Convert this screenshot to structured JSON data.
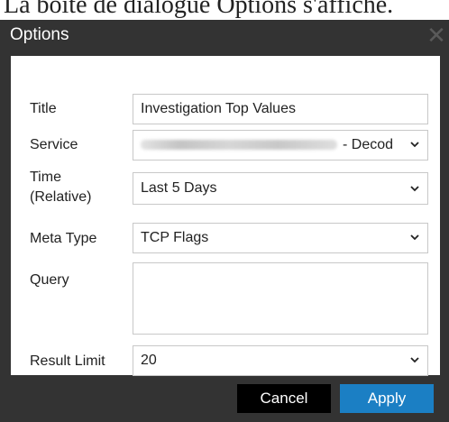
{
  "caption": "La boîte de dialogue Options s'affiche.",
  "dialog": {
    "title": "Options",
    "close_icon": "close-icon"
  },
  "form": {
    "title_label": "Title",
    "title_value": "Investigation Top Values",
    "service_label": "Service",
    "service_value_suffix": "- Decod",
    "time_label_line1": "Time",
    "time_label_line2": "(Relative)",
    "time_value": "Last 5 Days",
    "meta_type_label": "Meta Type",
    "meta_type_value": "TCP Flags",
    "query_label": "Query",
    "query_value": "",
    "result_limit_label": "Result Limit",
    "result_limit_value": "20"
  },
  "buttons": {
    "cancel_label": "Cancel",
    "apply_label": "Apply"
  },
  "colors": {
    "dialog_bg": "#333333",
    "apply_bg": "#1b7fc4",
    "cancel_bg": "#000000"
  }
}
